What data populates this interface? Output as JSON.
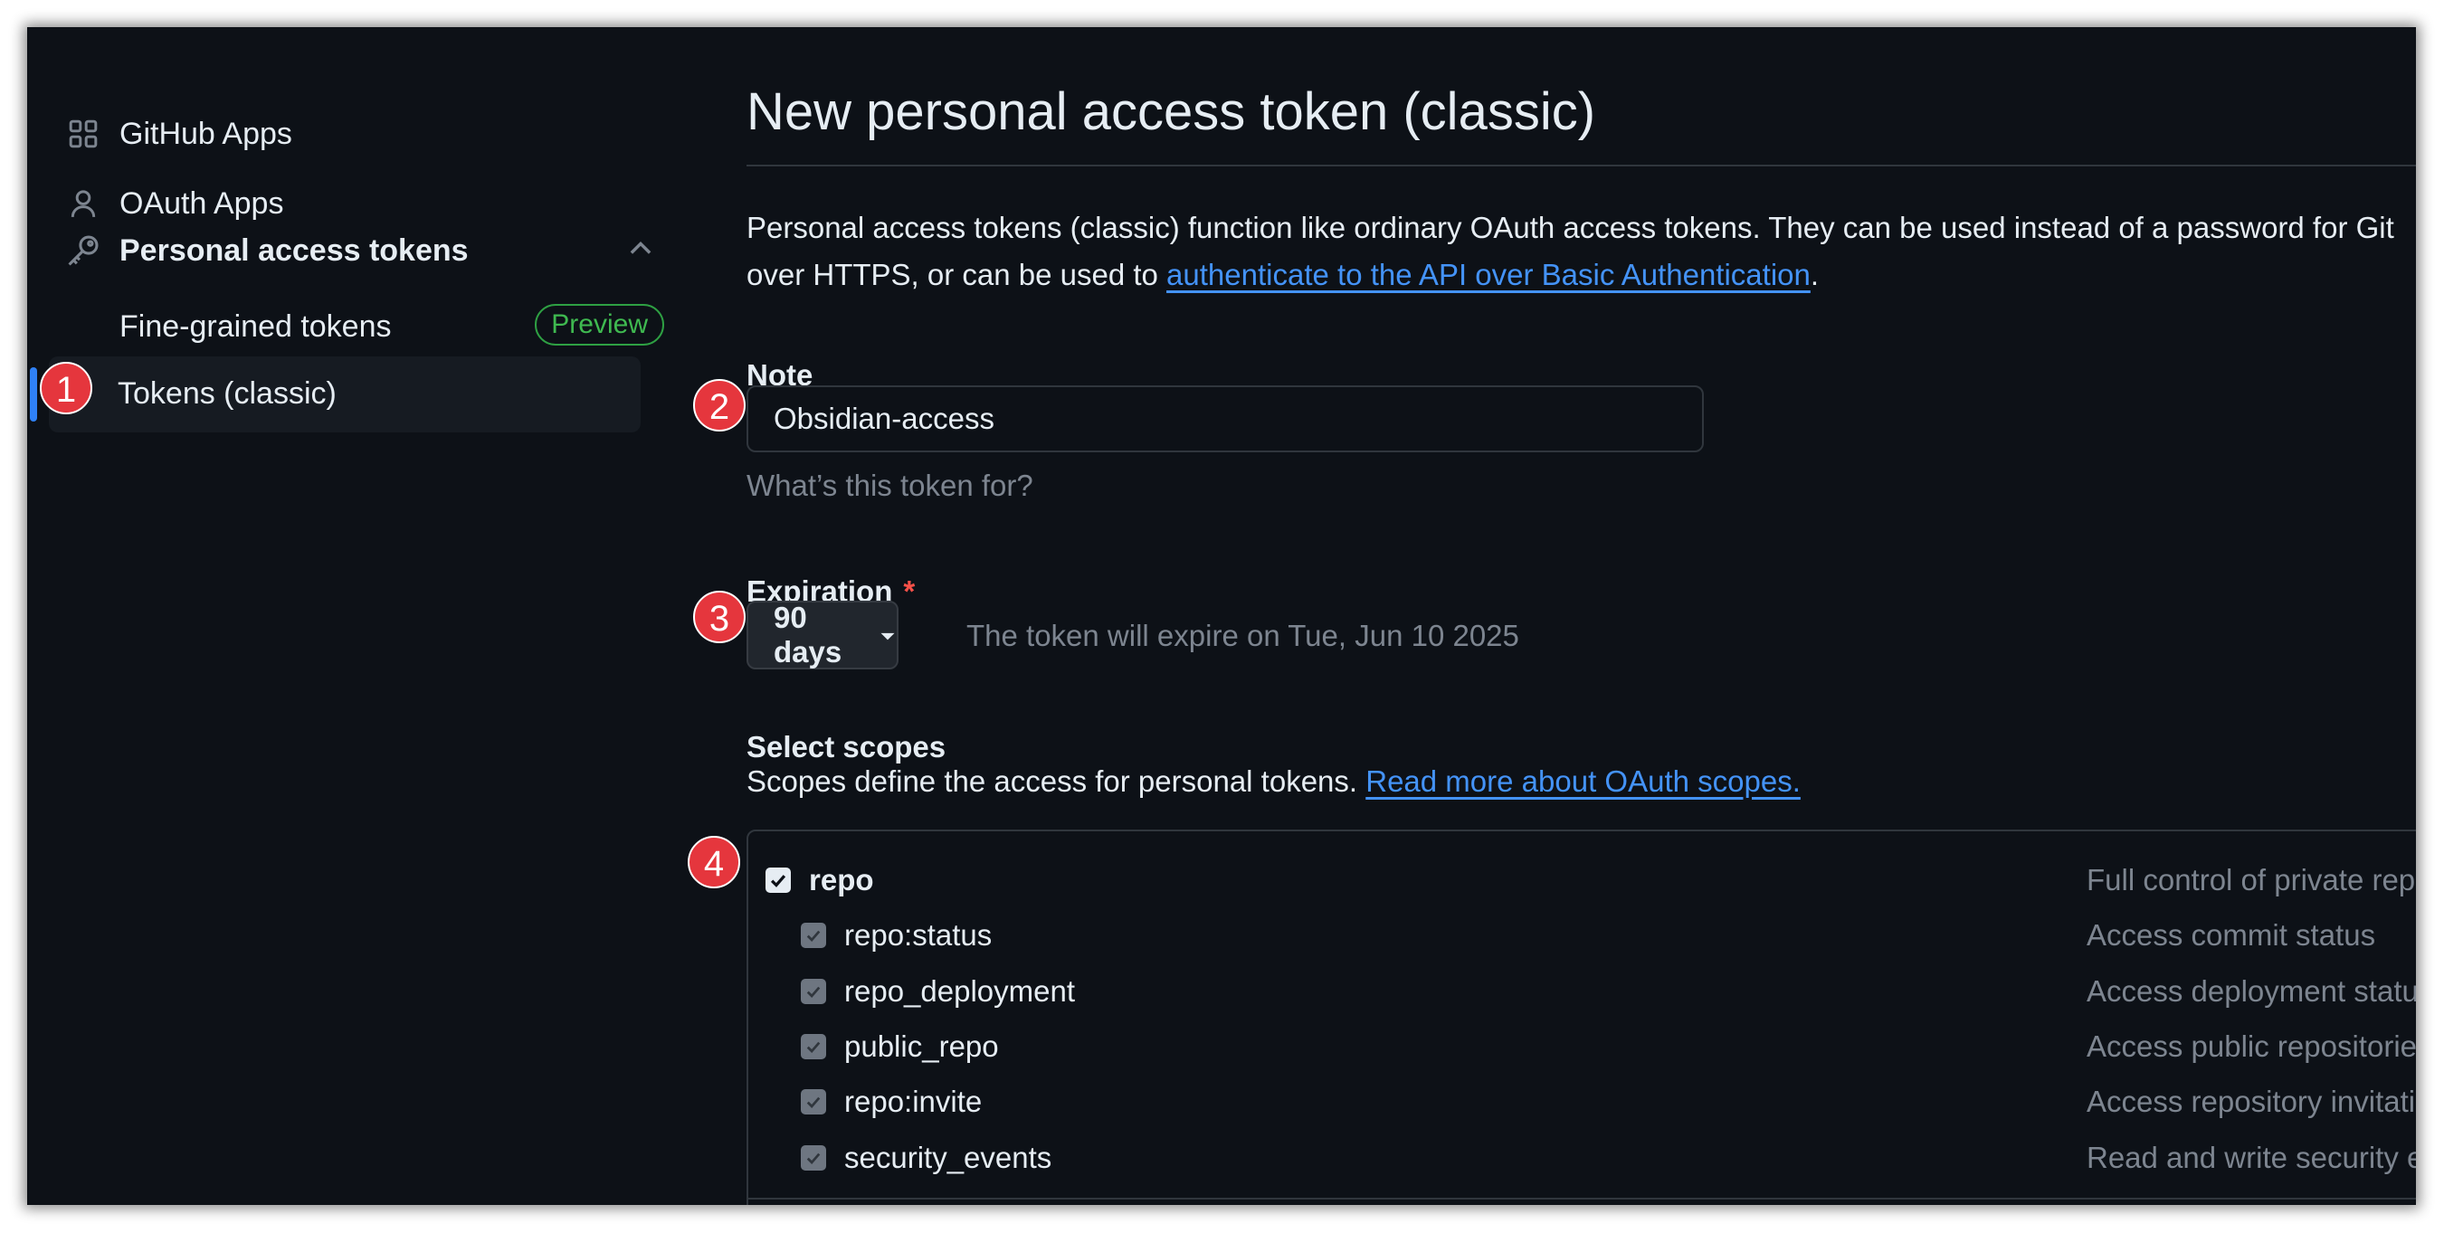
{
  "sidebar": {
    "items": [
      {
        "label": "GitHub Apps",
        "icon": "apps-grid-icon"
      },
      {
        "label": "OAuth Apps",
        "icon": "person-icon"
      },
      {
        "label": "Personal access tokens",
        "icon": "key-icon"
      }
    ],
    "sub_items": [
      {
        "label": "Fine-grained tokens",
        "badge": "Preview"
      },
      {
        "label": "Tokens (classic)",
        "selected": true
      }
    ]
  },
  "main": {
    "title": "New personal access token (classic)",
    "intro_text": "Personal access tokens (classic) function like ordinary OAuth access tokens. They can be used instead of a password for Git over HTTPS, or can be used to ",
    "intro_link": "authenticate to the API over Basic Authentication",
    "intro_end": ".",
    "note": {
      "label": "Note",
      "value": "Obsidian-access",
      "hint": "What’s this token for?"
    },
    "expiration": {
      "label": "Expiration",
      "required_mark": "*",
      "selected": "90 days",
      "note": "The token will expire on Tue, Jun 10 2025"
    },
    "scopes": {
      "heading": "Select scopes",
      "description": "Scopes define the access for personal tokens.",
      "link": "Read more about OAuth scopes.",
      "items": [
        {
          "name": "repo",
          "description": "Full control of private repositories",
          "checked": true,
          "level": 0
        },
        {
          "name": "repo:status",
          "description": "Access commit status",
          "checked": true,
          "level": 1
        },
        {
          "name": "repo_deployment",
          "description": "Access deployment status",
          "checked": true,
          "level": 1
        },
        {
          "name": "public_repo",
          "description": "Access public repositories",
          "checked": true,
          "level": 1
        },
        {
          "name": "repo:invite",
          "description": "Access repository invitations",
          "checked": true,
          "level": 1
        },
        {
          "name": "security_events",
          "description": "Read and write security events",
          "checked": true,
          "level": 1
        }
      ]
    }
  },
  "annotations": [
    "1",
    "2",
    "3",
    "4"
  ],
  "colors": {
    "background": "#0d1117",
    "accent_link": "#4493f8",
    "marker": "#e5363d",
    "preview_badge": "#3fb950",
    "selected_bar": "#2f81f7"
  }
}
